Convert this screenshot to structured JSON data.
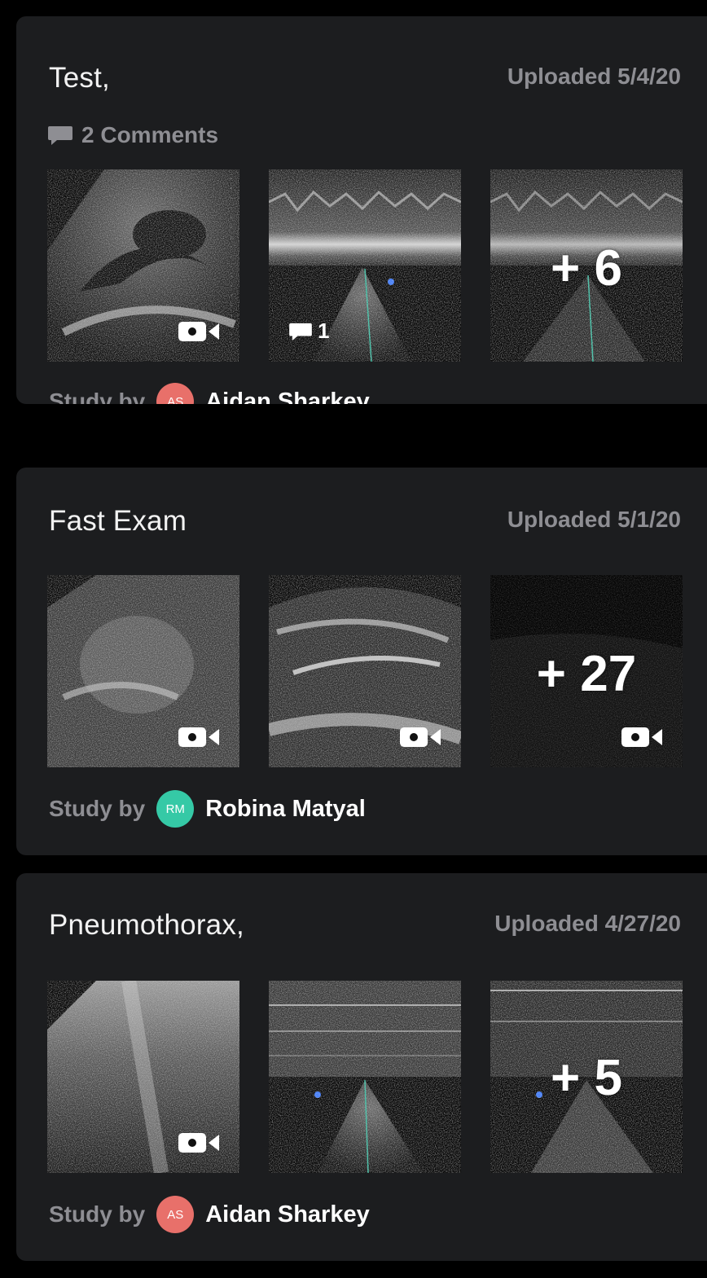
{
  "studies": [
    {
      "title": "Test,",
      "uploaded": "Uploaded 5/4/20",
      "comments": "2 Comments",
      "thumb_comment_count": "1",
      "more_count": "+ 6",
      "study_by_label": "Study by",
      "author_initials": "AS",
      "author_name": "Aidan Sharkey",
      "avatar_color": "#e8706a"
    },
    {
      "title": "Fast Exam",
      "uploaded": "Uploaded 5/1/20",
      "more_count": "+ 27",
      "study_by_label": "Study by",
      "author_initials": "RM",
      "author_name": "Robina Matyal",
      "avatar_color": "#35c9a6"
    },
    {
      "title": "Pneumothorax,",
      "uploaded": "Uploaded 4/27/20",
      "more_count": "+ 5",
      "study_by_label": "Study by",
      "author_initials": "AS",
      "author_name": "Aidan Sharkey",
      "avatar_color": "#e8706a"
    }
  ],
  "icons": {
    "comment": "comment-icon",
    "video": "video-camera-icon"
  }
}
